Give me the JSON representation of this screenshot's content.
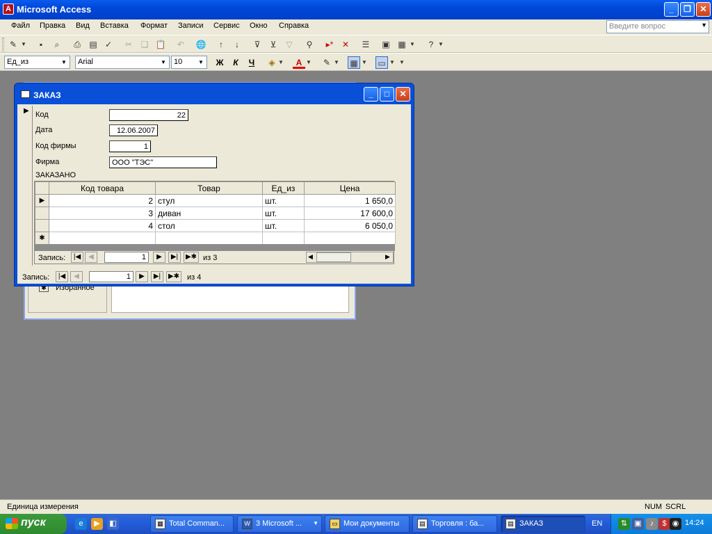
{
  "window": {
    "title": "Microsoft Access"
  },
  "menu": [
    "Файл",
    "Правка",
    "Вид",
    "Вставка",
    "Формат",
    "Записи",
    "Сервис",
    "Окно",
    "Справка"
  ],
  "help_box": {
    "placeholder": "Введите вопрос"
  },
  "format_toolbar": {
    "field_select": "Ед_из",
    "font": "Arial",
    "size": "10",
    "bold": "Ж",
    "italic": "К",
    "underline": "Ч"
  },
  "db_window": {
    "favorites": "Избранное"
  },
  "form": {
    "title": "ЗАКАЗ",
    "fields": {
      "kod": {
        "label": "Код",
        "value": "22"
      },
      "data": {
        "label": "Дата",
        "value": "12.06.2007"
      },
      "kod_firmy": {
        "label": "Код фирмы",
        "value": "1"
      },
      "firma": {
        "label": "Фирма",
        "value": "ООО \"ТЭС\""
      }
    },
    "subform_label": "ЗАКАЗАНО",
    "subform": {
      "columns": [
        "Код товара",
        "Товар",
        "Ед_из",
        "Цена"
      ],
      "rows": [
        {
          "kod": "2",
          "tovar": "стул",
          "ed": "шт.",
          "cena": "1 650,0"
        },
        {
          "kod": "3",
          "tovar": "диван",
          "ed": "шт.",
          "cena": "17 600,0"
        },
        {
          "kod": "4",
          "tovar": "стол",
          "ed": "шт.",
          "cena": "6 050,0"
        }
      ],
      "nav": {
        "label": "Запись:",
        "current": "1",
        "of": "из  3"
      }
    },
    "nav": {
      "label": "Запись:",
      "current": "1",
      "of": "из  4"
    }
  },
  "status": {
    "text": "Единица измерения",
    "num": "NUM",
    "scrl": "SCRL"
  },
  "taskbar": {
    "start": "пуск",
    "tasks": [
      "Total Comman...",
      "3 Microsoft ...",
      "Мои документы",
      "Торговля : ба...",
      "ЗАКАЗ"
    ],
    "lang": "EN",
    "clock": "14:24"
  }
}
